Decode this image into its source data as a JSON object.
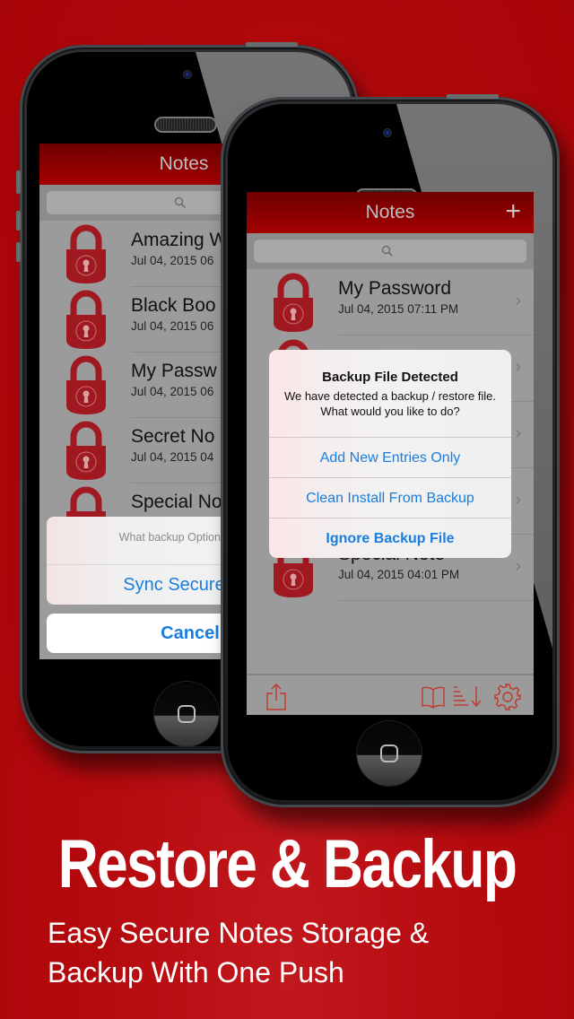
{
  "colors": {
    "background": "#b50a0e",
    "navbar": "#a50000",
    "lock": "#a01820",
    "ios_blue": "#1a7ee0",
    "toolbar_icon": "#c0392b"
  },
  "back_phone": {
    "nav_title": "Notes",
    "search_icon": "search-icon",
    "notes": [
      {
        "title": "Amazing W",
        "date": "Jul 04, 2015 06",
        "icon": "lock-icon"
      },
      {
        "title": "Black Boo",
        "date": "Jul 04, 2015 06",
        "icon": "lock-icon"
      },
      {
        "title": "My Passw",
        "date": "Jul 04, 2015 06",
        "icon": "lock-icon"
      },
      {
        "title": "Secret No",
        "date": "Jul 04, 2015 04",
        "icon": "lock-icon"
      },
      {
        "title": "Special No",
        "date": "",
        "icon": "lock-icon"
      }
    ],
    "action_sheet": {
      "message": "What backup Option do",
      "option": "Sync Secure N",
      "cancel": "Cancel"
    }
  },
  "front_phone": {
    "nav_title": "Notes",
    "add_icon": "+",
    "search_icon": "search-icon",
    "notes": [
      {
        "title": "My Password",
        "date": "Jul 04, 2015 07:11 PM",
        "icon": "lock-icon"
      },
      {
        "title": "",
        "date": "",
        "icon": "lock-icon"
      },
      {
        "title": "",
        "date": "",
        "icon": "lock-icon"
      },
      {
        "title": "",
        "date": "",
        "icon": "lock-icon"
      },
      {
        "title": "Special Note",
        "date": "Jul 04, 2015 04:01 PM",
        "icon": "lock-icon"
      }
    ],
    "chevron": "›",
    "alert": {
      "title": "Backup File Detected",
      "message": "We have detected a backup / restore file. What would you like to do?",
      "buttons": [
        "Add New Entries Only",
        "Clean Install From Backup",
        "Ignore Backup File"
      ]
    },
    "toolbar": {
      "left": "share-icon",
      "right": [
        "book-icon",
        "sort-icon",
        "gear-icon"
      ]
    }
  },
  "marketing": {
    "headline": "Restore & Backup",
    "subline_1": "Easy Secure Notes Storage &",
    "subline_2": "Backup With One Push"
  }
}
